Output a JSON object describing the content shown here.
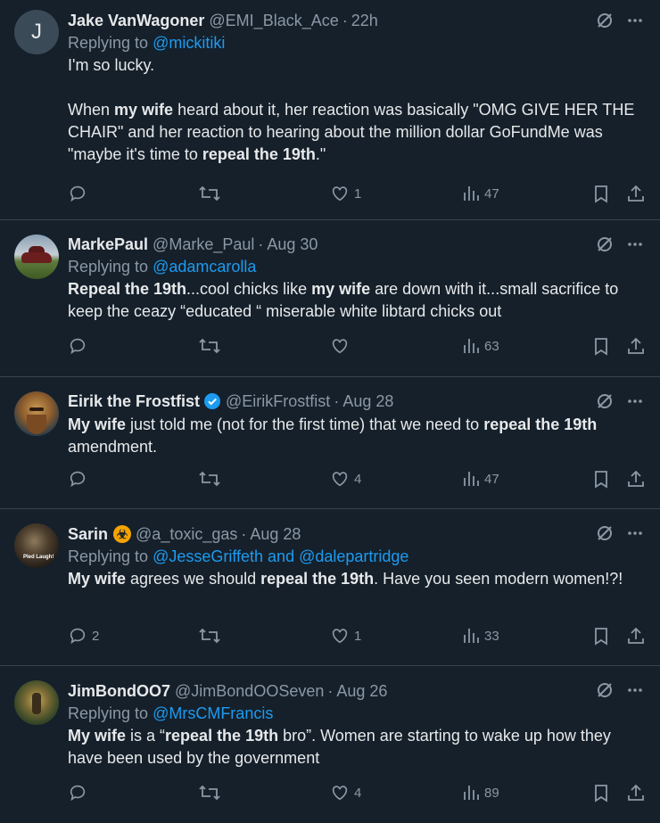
{
  "tweets": [
    {
      "avatar_letter": "J",
      "name": "Jake VanWagoner",
      "handle": "@EMI_Black_Ace",
      "time": "22h",
      "replying_prefix": "Replying to ",
      "replying_to": "@mickitiki",
      "lines": [
        "I'm so lucky.",
        "",
        "When |my wife| heard about it, her reaction was basically \"OMG GIVE HER THE CHAIR\" and her reaction to hearing about the million dollar GoFundMe was \"maybe it's time to |repeal the 19th|.\""
      ],
      "text_parts": {
        "p1": "I'm so lucky.",
        "p2a": "When ",
        "p2b": "my wife",
        "p2c": " heard about it, her reaction was basically \"OMG GIVE HER THE CHAIR\" and her reaction to hearing about the million dollar GoFundMe was \"maybe it's time to ",
        "p2d": "repeal the 19th",
        "p2e": ".\""
      },
      "replies": "",
      "retweets": "",
      "likes": "1",
      "views": "47"
    },
    {
      "name": "MarkePaul",
      "handle": "@Marke_Paul",
      "time": "Aug 30",
      "replying_prefix": "Replying to ",
      "replying_to": "@adamcarolla",
      "text_parts": {
        "a": "Repeal the 19th",
        "b": "...cool chicks like ",
        "c": "my wife",
        "d": " are down with it...small sacrifice to keep the ceazy “educated “ miserable white libtard chicks out"
      },
      "replies": "",
      "retweets": "",
      "likes": "",
      "views": "63"
    },
    {
      "name": "Eirik the Frostfist",
      "handle": "@EirikFrostfist",
      "time": "Aug 28",
      "text_parts": {
        "a": "My wife",
        "b": " just told me (not for the first time) that we need to ",
        "c": "repeal the 19th",
        "d": " amendment."
      },
      "replies": "",
      "retweets": "",
      "likes": "4",
      "views": "47"
    },
    {
      "name": "Sarin",
      "handle": "@a_toxic_gas",
      "time": "Aug 28",
      "avatar_caption": "Pled Laugh!",
      "replying_prefix": "Replying to ",
      "replying_to": "@JesseGriffeth and @dalepartridge",
      "text_parts": {
        "a": "My wife",
        "b": " agrees we should ",
        "c": "repeal the 19th",
        "d": ". Have you seen modern women!?!"
      },
      "replies": "2",
      "retweets": "",
      "likes": "1",
      "views": "33"
    },
    {
      "name": "JimBondOO7",
      "handle": "@JimBondOOSeven",
      "time": "Aug 26",
      "replying_prefix": "Replying to ",
      "replying_to": "@MrsCMFrancis",
      "text_parts": {
        "a": "My wife",
        "b": " is a “",
        "c": "repeal the 19th",
        "d": " bro”. Women are starting to wake up how they have been used by the government"
      },
      "replies": "",
      "retweets": "",
      "likes": "4",
      "views": "89"
    }
  ],
  "separator": "·",
  "icons": {
    "top": [
      "grok-icon",
      "more-icon"
    ],
    "actions": [
      "reply-icon",
      "retweet-icon",
      "like-icon",
      "views-icon",
      "bookmark-icon",
      "share-icon"
    ]
  },
  "colors": {
    "background": "#15202b",
    "text": "#e7e9ea",
    "secondary": "#8b98a5",
    "link": "#1d9bf0",
    "verified": "#1d9bf0",
    "hazard": "#f4a300"
  }
}
